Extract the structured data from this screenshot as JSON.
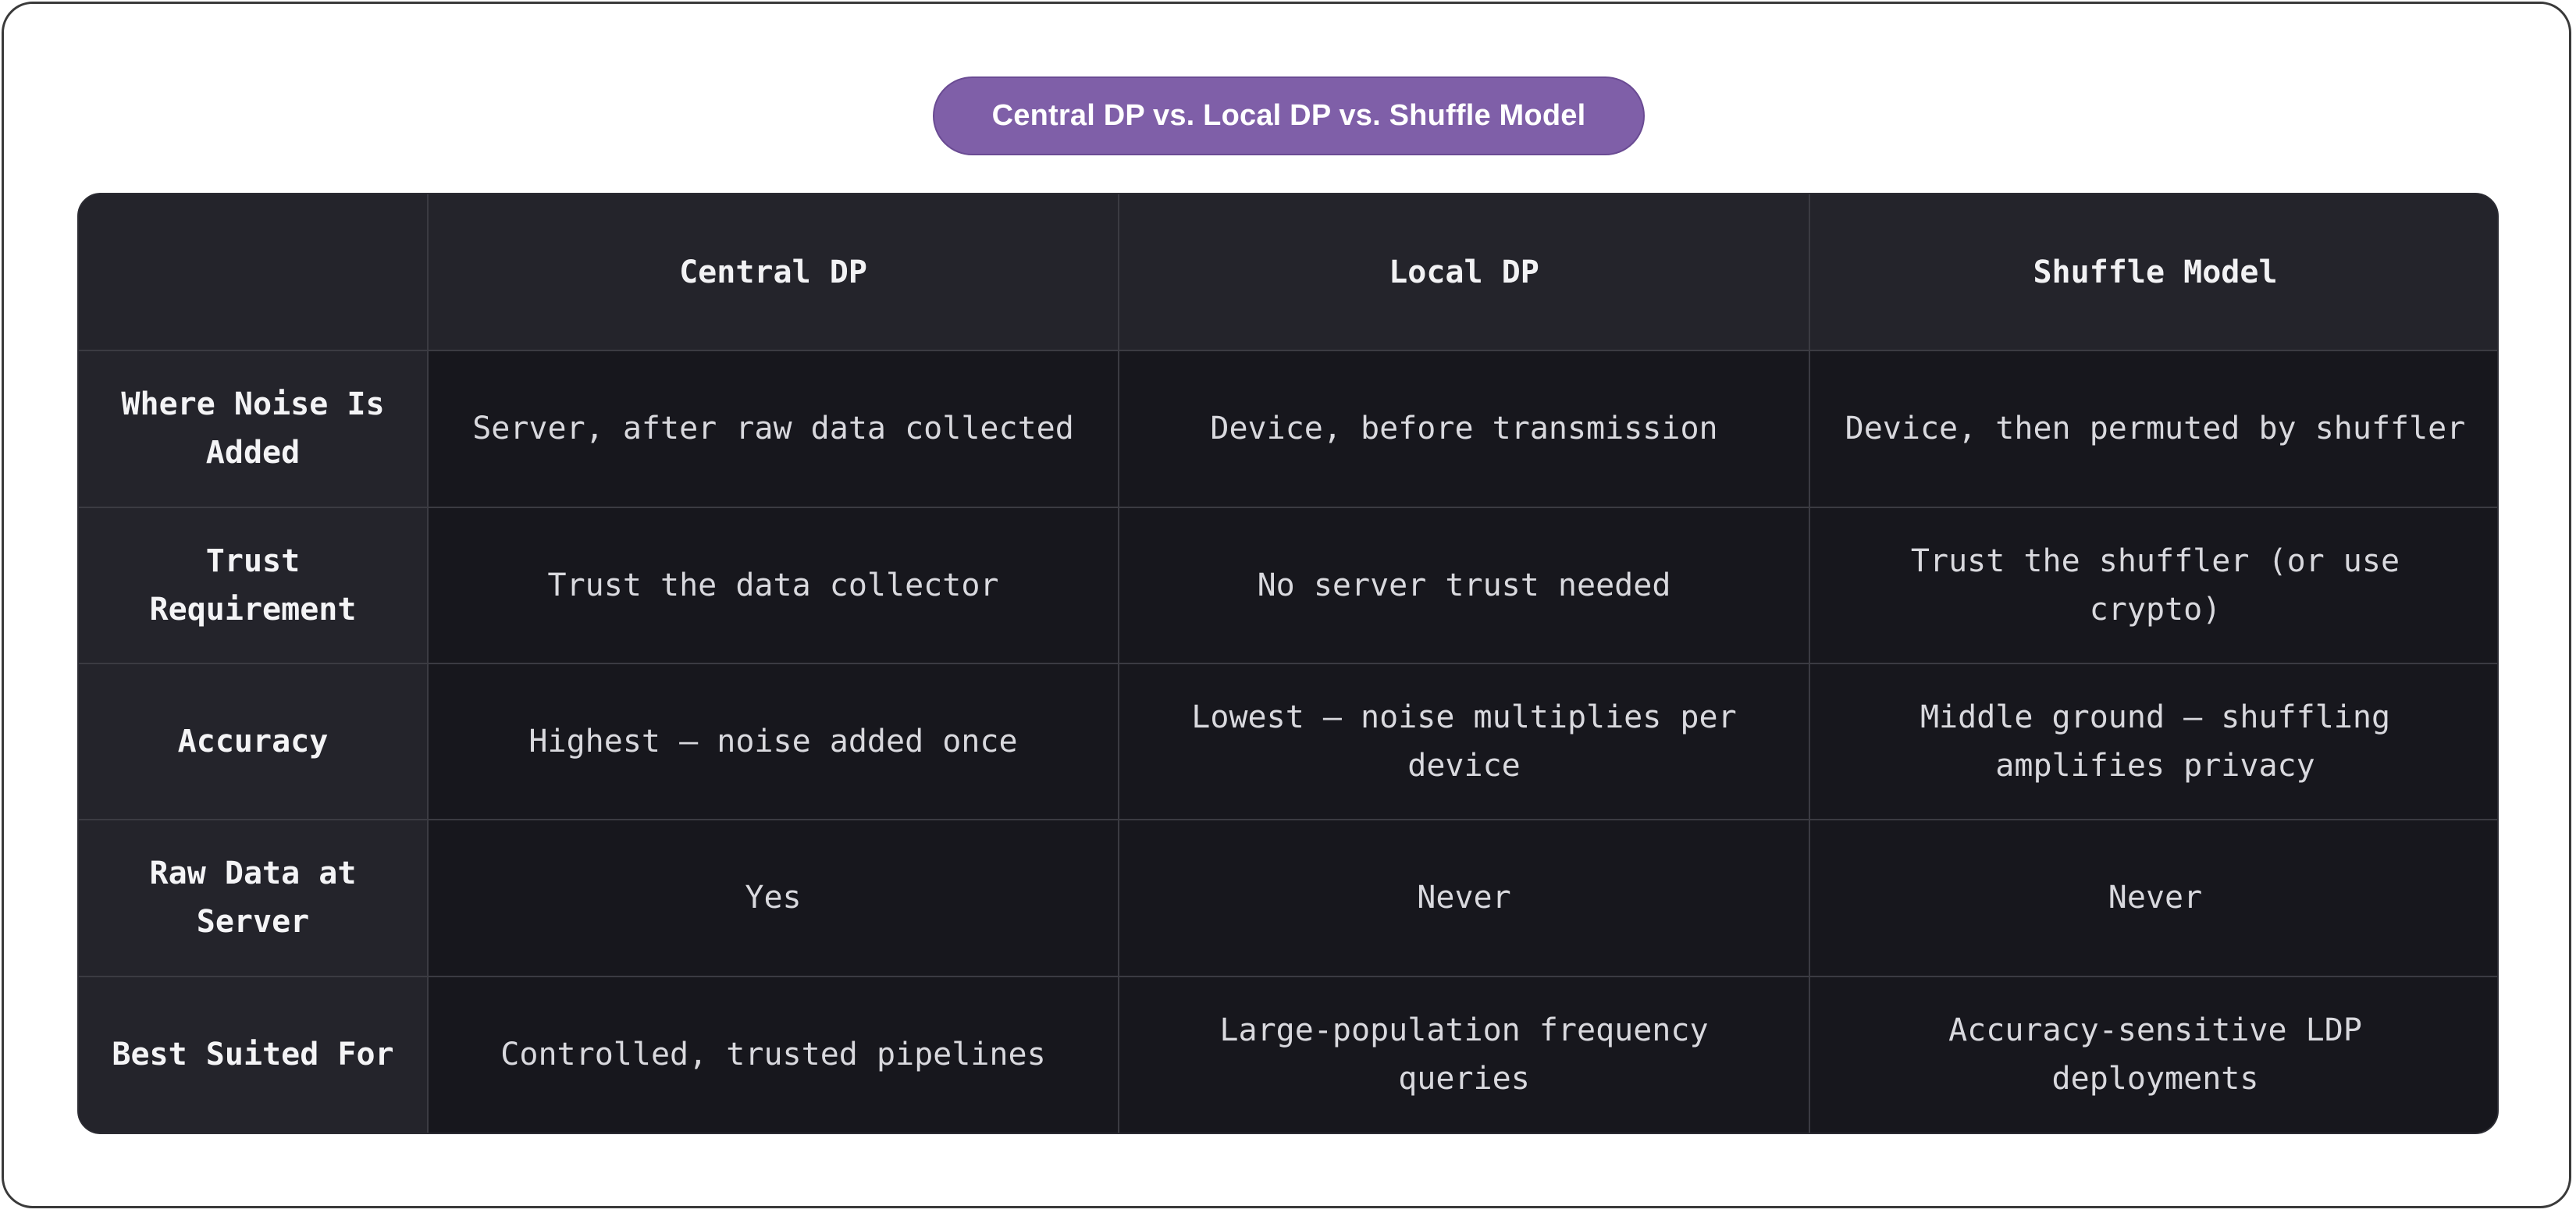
{
  "title": "Central DP vs. Local DP vs. Shuffle Model",
  "table": {
    "columns": [
      "",
      "Central DP",
      "Local DP",
      "Shuffle Model"
    ],
    "rows": [
      {
        "label": "Where Noise Is Added",
        "cells": [
          "Server, after raw data collected",
          "Device, before transmission",
          "Device, then permuted by shuffler"
        ]
      },
      {
        "label": "Trust Requirement",
        "cells": [
          "Trust the data collector",
          "No server trust needed",
          "Trust the shuffler (or use crypto)"
        ]
      },
      {
        "label": "Accuracy",
        "cells": [
          "Highest — noise added once",
          "Lowest — noise multiplies per device",
          "Middle ground — shuffling amplifies privacy"
        ]
      },
      {
        "label": "Raw Data at Server",
        "cells": [
          "Yes",
          "Never",
          "Never"
        ]
      },
      {
        "label": "Best Suited For",
        "cells": [
          "Controlled, trusted pipelines",
          "Large-population frequency queries",
          "Accuracy-sensitive LDP deployments"
        ]
      }
    ]
  },
  "colors": {
    "title_pill": "#7f5fa8",
    "table_bg": "#18181f",
    "header_bg": "#24242b",
    "grid_line": "#3b3b42"
  }
}
